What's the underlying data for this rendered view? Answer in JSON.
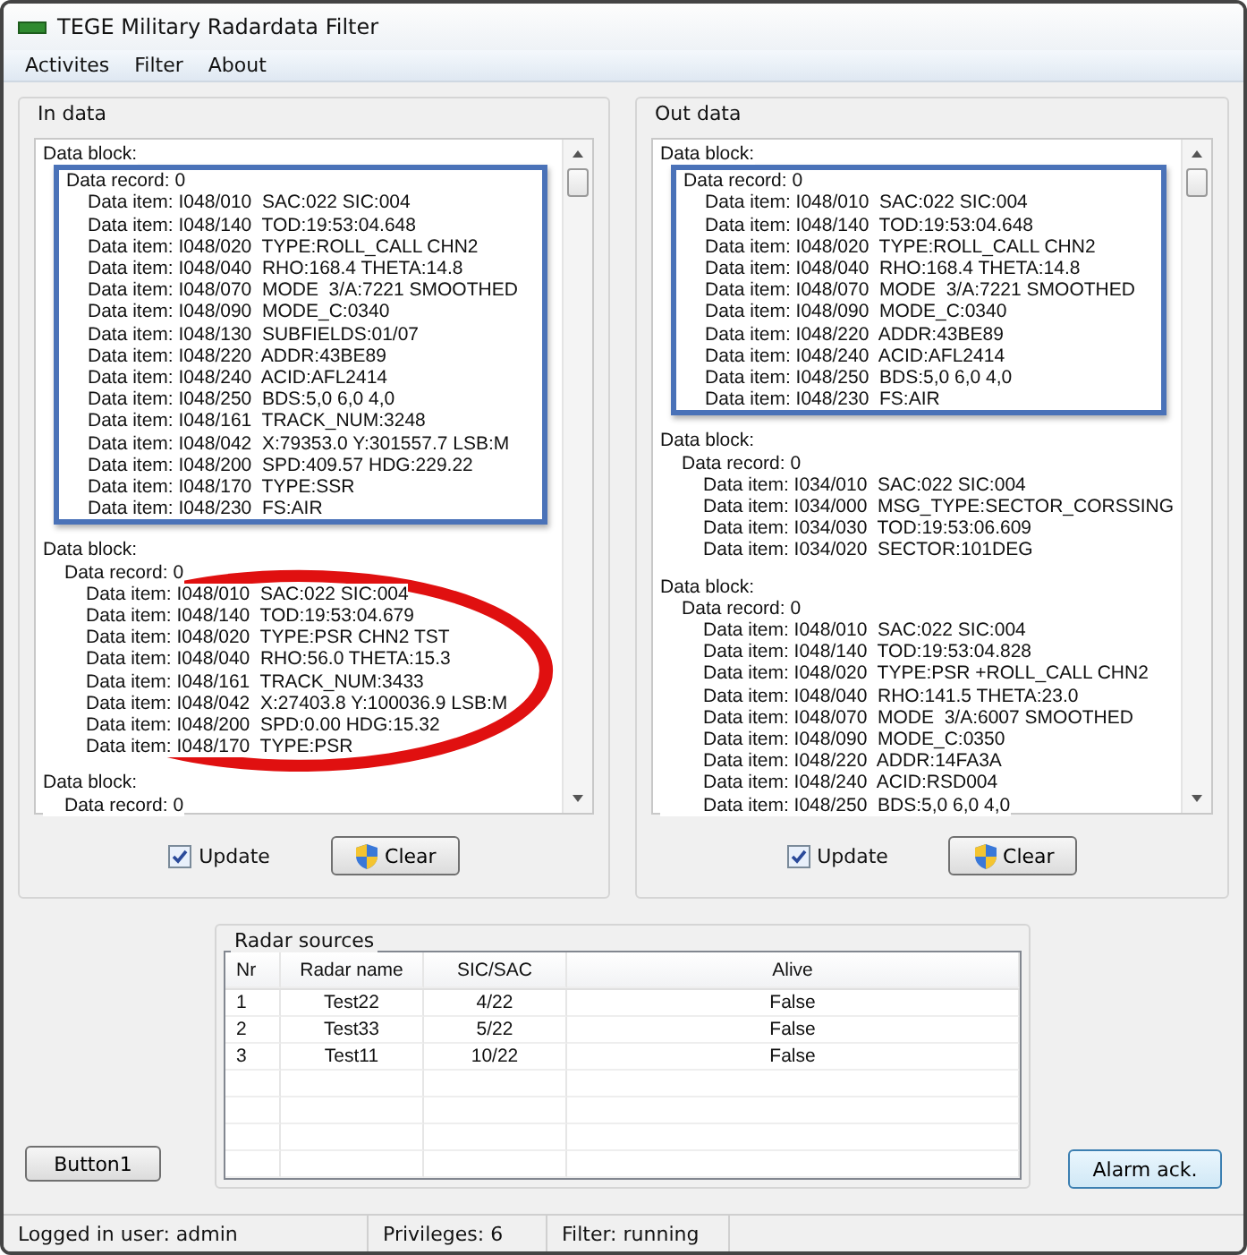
{
  "window": {
    "title": "TEGE Military Radardata Filter"
  },
  "menu": [
    "Activites",
    "Filter",
    "About"
  ],
  "panels": [
    {
      "title": "In data",
      "update_label": "Update",
      "update_checked": true,
      "clear_label": "Clear",
      "blocks": [
        {
          "header": "Data block:",
          "record": "Data record: 0",
          "boxed": true,
          "circled": false,
          "items": [
            "Data item: I048/010  SAC:022 SIC:004",
            "Data item: I048/140  TOD:19:53:04.648",
            "Data item: I048/020  TYPE:ROLL_CALL CHN2",
            "Data item: I048/040  RHO:168.4 THETA:14.8",
            "Data item: I048/070  MODE  3/A:7221 SMOOTHED",
            "Data item: I048/090  MODE_C:0340",
            "Data item: I048/130  SUBFIELDS:01/07",
            "Data item: I048/220  ADDR:43BE89",
            "Data item: I048/240  ACID:AFL2414",
            "Data item: I048/250  BDS:5,0 6,0 4,0",
            "Data item: I048/161  TRACK_NUM:3248",
            "Data item: I048/042  X:79353.0 Y:301557.7 LSB:M",
            "Data item: I048/200  SPD:409.57 HDG:229.22",
            "Data item: I048/170  TYPE:SSR",
            "Data item: I048/230  FS:AIR"
          ]
        },
        {
          "header": "Data block:",
          "record": "Data record: 0",
          "boxed": false,
          "circled": true,
          "items": [
            "Data item: I048/010  SAC:022 SIC:004",
            "Data item: I048/140  TOD:19:53:04.679",
            "Data item: I048/020  TYPE:PSR CHN2 TST",
            "Data item: I048/040  RHO:56.0 THETA:15.3",
            "Data item: I048/161  TRACK_NUM:3433",
            "Data item: I048/042  X:27403.8 Y:100036.9 LSB:M",
            "Data item: I048/200  SPD:0.00 HDG:15.32",
            "Data item: I048/170  TYPE:PSR"
          ]
        },
        {
          "header": "Data block:",
          "record": "Data record: 0",
          "boxed": false,
          "circled": false
        }
      ]
    },
    {
      "title": "Out data",
      "update_label": "Update",
      "update_checked": true,
      "clear_label": "Clear",
      "blocks": [
        {
          "header": "Data block:",
          "record": "Data record: 0",
          "boxed": true,
          "circled": false,
          "items": [
            "Data item: I048/010  SAC:022 SIC:004",
            "Data item: I048/140  TOD:19:53:04.648",
            "Data item: I048/020  TYPE:ROLL_CALL CHN2",
            "Data item: I048/040  RHO:168.4 THETA:14.8",
            "Data item: I048/070  MODE  3/A:7221 SMOOTHED",
            "Data item: I048/090  MODE_C:0340",
            "Data item: I048/220  ADDR:43BE89",
            "Data item: I048/240  ACID:AFL2414",
            "Data item: I048/250  BDS:5,0 6,0 4,0",
            "Data item: I048/230  FS:AIR"
          ]
        },
        {
          "header": "Data block:",
          "record": "Data record: 0",
          "boxed": false,
          "circled": false,
          "items": [
            "Data item: I034/010  SAC:022 SIC:004",
            "Data item: I034/000  MSG_TYPE:SECTOR_CORSSING",
            "Data item: I034/030  TOD:19:53:06.609",
            "Data item: I034/020  SECTOR:101DEG"
          ]
        },
        {
          "header": "Data block:",
          "record": "Data record: 0",
          "boxed": false,
          "circled": false,
          "items": [
            "Data item: I048/010  SAC:022 SIC:004",
            "Data item: I048/140  TOD:19:53:04.828",
            "Data item: I048/020  TYPE:PSR +ROLL_CALL CHN2",
            "Data item: I048/040  RHO:141.5 THETA:23.0",
            "Data item: I048/070  MODE  3/A:6007 SMOOTHED",
            "Data item: I048/090  MODE_C:0350",
            "Data item: I048/220  ADDR:14FA3A",
            "Data item: I048/240  ACID:RSD004",
            "Data item: I048/250  BDS:5,0 6,0 4,0"
          ]
        }
      ]
    }
  ],
  "radar_sources": {
    "title": "Radar sources",
    "columns": [
      "Nr",
      "Radar name",
      "SIC/SAC",
      "Alive"
    ],
    "rows": [
      [
        "1",
        "Test22",
        "4/22",
        "False"
      ],
      [
        "2",
        "Test33",
        "5/22",
        "False"
      ],
      [
        "3",
        "Test11",
        "10/22",
        "False"
      ]
    ]
  },
  "buttons": {
    "left": "Button1",
    "right": "Alarm ack."
  },
  "status_bar": [
    "Logged in user: admin",
    "Privileges: 6",
    "Filter: running"
  ]
}
